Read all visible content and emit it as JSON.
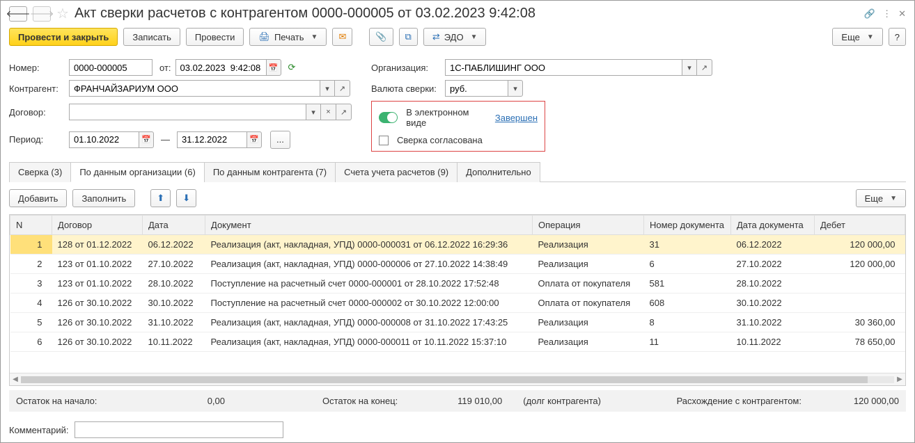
{
  "title": "Акт сверки расчетов с контрагентом 0000-000005 от 03.02.2023 9:42:08",
  "toolbar": {
    "post_close": "Провести и закрыть",
    "write": "Записать",
    "post": "Провести",
    "print": "Печать",
    "edo": "ЭДО",
    "more": "Еще",
    "help": "?"
  },
  "form": {
    "number_label": "Номер:",
    "number": "0000-000005",
    "from_label": "от:",
    "date": "03.02.2023  9:42:08",
    "org_label": "Организация:",
    "org": "1С-ПАБЛИШИНГ ООО",
    "counterparty_label": "Контрагент:",
    "counterparty": "ФРАНЧАЙЗАРИУМ ООО",
    "currency_label": "Валюта сверки:",
    "currency": "руб.",
    "contract_label": "Договор:",
    "contract": "",
    "period_label": "Период:",
    "period_from": "01.10.2022",
    "period_to": "31.12.2022",
    "period_sep": "—",
    "ellipsis": "...",
    "electronic_label": "В электронном виде",
    "status_link": "Завершен",
    "agreed_label": "Сверка согласована"
  },
  "tabs": [
    "Сверка (3)",
    "По данным организации (6)",
    "По данным контрагента (7)",
    "Счета учета расчетов (9)",
    "Дополнительно"
  ],
  "tabs_active_index": 1,
  "table_toolbar": {
    "add": "Добавить",
    "fill": "Заполнить",
    "more": "Еще"
  },
  "columns": [
    "N",
    "Договор",
    "Дата",
    "Документ",
    "Операция",
    "Номер документа",
    "Дата документа",
    "Дебет"
  ],
  "rows": [
    {
      "n": "1",
      "contract": "128 от 01.12.2022",
      "date": "06.12.2022",
      "doc": "Реализация (акт, накладная, УПД) 0000-000031 от 06.12.2022 16:29:36",
      "op": "Реализация",
      "docnum": "31",
      "docdate": "06.12.2022",
      "debit": "120 000,00",
      "selected": true
    },
    {
      "n": "2",
      "contract": "123 от 01.10.2022",
      "date": "27.10.2022",
      "doc": "Реализация (акт, накладная, УПД) 0000-000006 от 27.10.2022 14:38:49",
      "op": "Реализация",
      "docnum": "6",
      "docdate": "27.10.2022",
      "debit": "120 000,00"
    },
    {
      "n": "3",
      "contract": "123 от 01.10.2022",
      "date": "28.10.2022",
      "doc": "Поступление на расчетный счет 0000-000001 от 28.10.2022 17:52:48",
      "op": "Оплата от покупателя",
      "docnum": "581",
      "docdate": "28.10.2022",
      "debit": ""
    },
    {
      "n": "4",
      "contract": "126 от 30.10.2022",
      "date": "30.10.2022",
      "doc": "Поступление на расчетный счет 0000-000002 от 30.10.2022 12:00:00",
      "op": "Оплата от покупателя",
      "docnum": "608",
      "docdate": "30.10.2022",
      "debit": ""
    },
    {
      "n": "5",
      "contract": "126 от 30.10.2022",
      "date": "31.10.2022",
      "doc": "Реализация (акт, накладная, УПД) 0000-000008 от 31.10.2022 17:43:25",
      "op": "Реализация",
      "docnum": "8",
      "docdate": "31.10.2022",
      "debit": "30 360,00"
    },
    {
      "n": "6",
      "contract": "126 от 30.10.2022",
      "date": "10.11.2022",
      "doc": "Реализация (акт, накладная, УПД) 0000-000011 от 10.11.2022 15:37:10",
      "op": "Реализация",
      "docnum": "11",
      "docdate": "10.11.2022",
      "debit": "78 650,00"
    }
  ],
  "summary": {
    "start_label": "Остаток на начало:",
    "start_val": "0,00",
    "end_label": "Остаток на конец:",
    "end_val": "119 010,00",
    "end_note": "(долг контрагента)",
    "diff_label": "Расхождение с контрагентом:",
    "diff_val": "120 000,00"
  },
  "comment_label": "Комментарий:",
  "comment_value": ""
}
